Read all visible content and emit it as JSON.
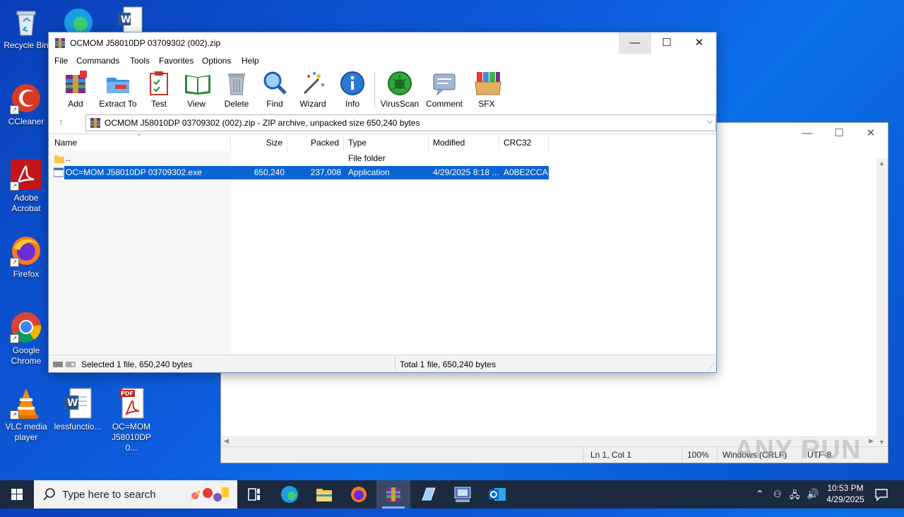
{
  "desktop": {
    "icons": [
      {
        "label": "Recycle Bin",
        "icon": "recycle-bin-icon"
      },
      {
        "label": "CCleaner",
        "icon": "ccleaner-icon"
      },
      {
        "label": "Adobe Acrobat",
        "icon": "adobe-acrobat-icon"
      },
      {
        "label": "Firefox",
        "icon": "firefox-icon"
      },
      {
        "label": "Google Chrome",
        "icon": "chrome-icon"
      },
      {
        "label": "VLC media player",
        "icon": "vlc-icon"
      },
      {
        "label": "lessfunctio...",
        "icon": "word-document-icon"
      },
      {
        "label": "OC=MOM J58010DP 0...",
        "icon": "pdf-document-icon"
      }
    ]
  },
  "notepad": {
    "status": {
      "position": "Ln 1, Col 1",
      "zoom": "100%",
      "line_ending": "Windows (CRLF)",
      "encoding": "UTF-8"
    }
  },
  "winrar": {
    "title": "OCMOM J58010DP 03709302 (002).zip",
    "menu": [
      "File",
      "Commands",
      "Tools",
      "Favorites",
      "Options",
      "Help"
    ],
    "toolbar": [
      {
        "label": "Add",
        "icon": "add-archive-icon"
      },
      {
        "label": "Extract To",
        "icon": "extract-folder-icon"
      },
      {
        "label": "Test",
        "icon": "test-clipboard-icon"
      },
      {
        "label": "View",
        "icon": "view-book-icon"
      },
      {
        "label": "Delete",
        "icon": "trash-icon"
      },
      {
        "label": "Find",
        "icon": "magnifier-icon"
      },
      {
        "label": "Wizard",
        "icon": "magic-wand-icon"
      },
      {
        "label": "Info",
        "icon": "info-icon"
      },
      {
        "label": "VirusScan",
        "icon": "virus-scan-icon"
      },
      {
        "label": "Comment",
        "icon": "comment-icon"
      },
      {
        "label": "SFX",
        "icon": "sfx-box-icon"
      }
    ],
    "address": "OCMOM J58010DP 03709302 (002).zip - ZIP archive, unpacked size 650,240 bytes",
    "columns": [
      "Name",
      "Size",
      "Packed",
      "Type",
      "Modified",
      "CRC32"
    ],
    "rows": [
      {
        "name": "..",
        "size": "",
        "packed": "",
        "type": "File folder",
        "modified": "",
        "crc": ""
      },
      {
        "name": "OC=MOM J58010DP 03709302.exe",
        "size": "650,240",
        "packed": "237,008",
        "type": "Application",
        "modified": "4/29/2025 8:18 ...",
        "crc": "A0BE2CCA"
      }
    ],
    "status_left": "Selected 1 file, 650,240 bytes",
    "status_right": "Total 1 file, 650,240 bytes"
  },
  "taskbar": {
    "search_placeholder": "Type here to search",
    "time": "10:53 PM",
    "date": "4/29/2025"
  },
  "watermark": "ANY RUN"
}
